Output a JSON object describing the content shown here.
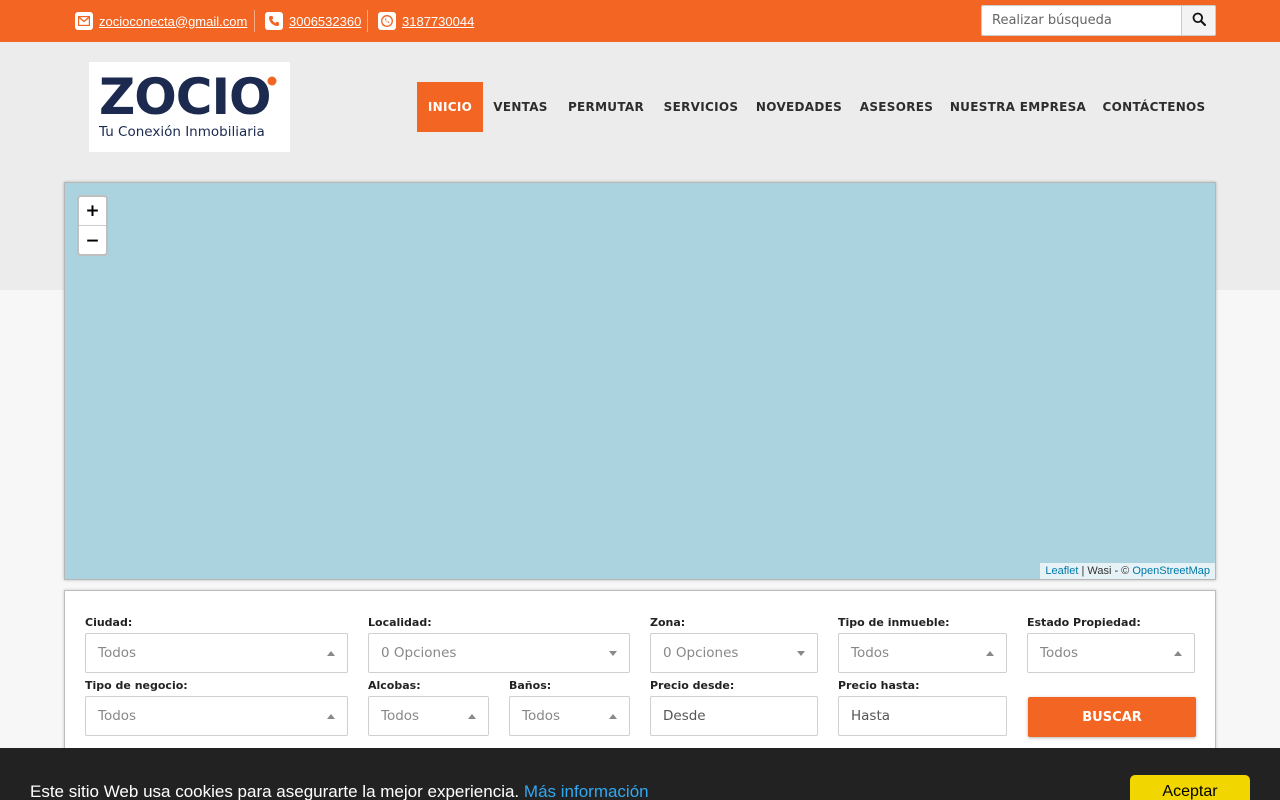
{
  "topbar": {
    "email": "zocioconecta@gmail.com",
    "phone": "3006532360",
    "whatsapp": "3187730044",
    "search_placeholder": "Realizar búsqueda"
  },
  "logo": {
    "brand": "ZOCIO",
    "tagline": "Tu Conexión Inmobiliaria"
  },
  "nav": [
    "INICIO",
    "VENTAS",
    "PERMUTAR",
    "SERVICIOS",
    "NOVEDADES",
    "ASESORES",
    "NUESTRA EMPRESA",
    "CONTÁCTENOS"
  ],
  "map": {
    "zoom_in": "+",
    "zoom_out": "−",
    "attribution_leaflet": "Leaflet",
    "attribution_mid": " | Wasi - © ",
    "attribution_osm": "OpenStreetMap"
  },
  "filters": {
    "ciudad": {
      "label": "Ciudad:",
      "value": "Todos"
    },
    "localidad": {
      "label": "Localidad:",
      "value": "0 Opciones"
    },
    "zona": {
      "label": "Zona:",
      "value": "0 Opciones"
    },
    "tipo_inmueble": {
      "label": "Tipo de inmueble:",
      "value": "Todos"
    },
    "estado": {
      "label": "Estado Propiedad:",
      "value": "Todos"
    },
    "tipo_negocio": {
      "label": "Tipo de negocio:",
      "value": "Todos"
    },
    "alcobas": {
      "label": "Alcobas:",
      "value": "Todos"
    },
    "banos": {
      "label": "Baños:",
      "value": "Todos"
    },
    "precio_desde": {
      "label": "Precio desde:",
      "placeholder": "Desde"
    },
    "precio_hasta": {
      "label": "Precio hasta:",
      "placeholder": "Hasta"
    },
    "search_button": "BUSCAR"
  },
  "cookie": {
    "message": "Este sitio Web usa cookies para asegurarte la mejor experiencia.",
    "more_link": "Más información",
    "accept": "Aceptar"
  },
  "colors": {
    "accent": "#f26522",
    "navy": "#1b2a4e",
    "map_water": "#aad3df",
    "cookie_bg": "#222222",
    "cookie_button": "#f1d600"
  }
}
